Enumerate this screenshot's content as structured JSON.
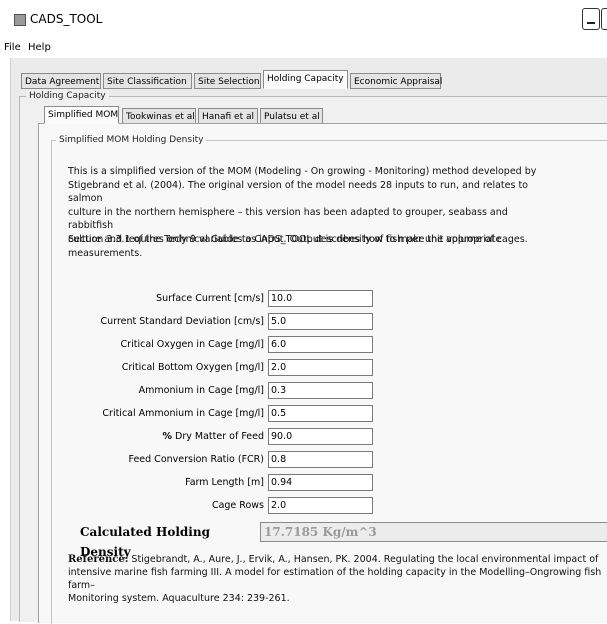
{
  "window": {
    "title": "CADS_TOOL"
  },
  "menubar": {
    "items": [
      "File",
      "Help"
    ]
  },
  "main_tabs": [
    "Data Agreement",
    "Site Classification",
    "Site Selection",
    "Holding Capacity",
    "Economic Appraisal"
  ],
  "active_main_tab": "Holding Capacity",
  "holding_panel": {
    "title": "Holding Capacity"
  },
  "model_tabs": [
    "Simplified MOM",
    "Tookwinas et al",
    "Hanafi et al",
    "Pulatsu et al"
  ],
  "active_model_tab": "Simplified MOM",
  "mom": {
    "box_title": "Simplified MOM Holding Density",
    "description": [
      "This is a simplified version of the MOM (Modeling - On growing - Monitoring) method developed by",
      "Stigebrand et al. (2004). The original version of the model needs 28 inputs to run, and relates to salmon",
      "culture in the northern hemisphere – this version has been adapted to grouper, seabass and rabbitfish",
      "culture and requires only 9 variables as input. Output is density of fish per unit volume of cages."
    ],
    "section_note": [
      "Section 3.3.1 of the Technical Guide to CADS_TOOL describes how to make the appropriate",
      "measurements."
    ],
    "fields": [
      {
        "label": "Surface Current [cm/s]",
        "value": "10.0"
      },
      {
        "label": "Current Standard Deviation [cm/s]",
        "value": "5.0"
      },
      {
        "label": "Critical Oxygen in Cage [mg/l]",
        "value": "6.0"
      },
      {
        "label": "Critical Bottom Oxygen [mg/l]",
        "value": "2.0"
      },
      {
        "label": "Ammonium in Cage [mg/l]",
        "value": "0.3"
      },
      {
        "label": "Critical Ammonium in Cage [mg/l]",
        "value": "0.5"
      },
      {
        "label_bold": "%",
        "label": "Dry Matter of Feed",
        "value": "90.0"
      },
      {
        "label": "Feed Conversion Ratio (FCR)",
        "value": "0.8"
      },
      {
        "label": "Farm Length [m]",
        "value": "0.94"
      },
      {
        "label": "Cage Rows",
        "value": "2.0"
      }
    ],
    "result": {
      "label": "Calculated Holding Density",
      "value": "17.7185 Kg/m^3"
    },
    "reference": {
      "heading": "Reference:",
      "text": "Stigebrandt, A., Aure, J., Ervik, A., Hansen, PK. 2004. Regulating the local environmental impact of",
      "lines": [
        "intensive marine fish farming III. A model for estimation of the holding capacity in the Modelling–Ongrowing fish farm–",
        "Monitoring system. Aquaculture 234: 239-261."
      ]
    }
  }
}
